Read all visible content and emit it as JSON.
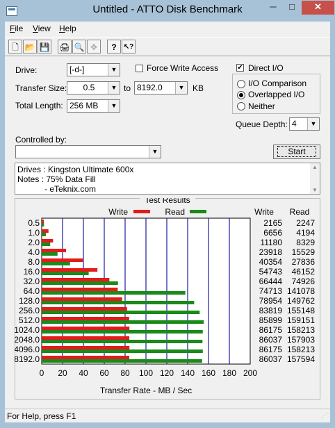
{
  "window": {
    "title": "Untitled - ATTO Disk Benchmark",
    "minimize": "─",
    "maximize": "□",
    "close": "✕"
  },
  "menu": [
    {
      "label": "File",
      "key": "F",
      "rest": "ile"
    },
    {
      "label": "View",
      "key": "V",
      "rest": "iew"
    },
    {
      "label": "Help",
      "key": "H",
      "rest": "elp"
    }
  ],
  "toolbar": [
    {
      "name": "new-icon",
      "glyph": "🗋"
    },
    {
      "name": "open-icon",
      "glyph": "📂"
    },
    {
      "name": "save-icon",
      "glyph": "💾"
    },
    {
      "name": "print-icon",
      "glyph": "🖨"
    },
    {
      "name": "print-preview-icon",
      "glyph": "🔍"
    },
    {
      "name": "move-icon",
      "glyph": "✥"
    },
    {
      "name": "help-icon",
      "glyph": "?"
    },
    {
      "name": "context-help-icon",
      "glyph": "↖?"
    }
  ],
  "settings": {
    "drive_label": "Drive:",
    "drive_value": "[-d-]",
    "transfer_size_label": "Transfer Size:",
    "transfer_from": "0.5",
    "to_label": "to",
    "transfer_to": "8192.0",
    "unit": "KB",
    "total_length_label": "Total Length:",
    "total_length_value": "256 MB",
    "force_write_label": "Force Write Access",
    "force_write_checked": false,
    "direct_io_label": "Direct I/O",
    "direct_io_checked": true,
    "io_comparison_label": "I/O Comparison",
    "overlapped_io_label": "Overlapped I/O",
    "neither_label": "Neither",
    "selected_mode": "Overlapped I/O",
    "queue_depth_label": "Queue Depth:",
    "queue_depth_value": "4",
    "controlled_by_label": "Controlled by:",
    "controlled_by_value": "",
    "start_label": "Start"
  },
  "notes": {
    "line1": "Drives : Kingston Ultimate 600x",
    "line2": "Notes : 75% Data Fill",
    "line3": "- eTeknix.com"
  },
  "results_title": "Test Results",
  "legend": {
    "write": "Write",
    "read": "Read",
    "write_color": "#e31b1b",
    "read_color": "#1a8a1a"
  },
  "table_headers": {
    "write": "Write",
    "read": "Read"
  },
  "chart_data": {
    "type": "bar",
    "orientation": "horizontal",
    "categories": [
      "0.5",
      "1.0",
      "2.0",
      "4.0",
      "8.0",
      "16.0",
      "32.0",
      "64.0",
      "128.0",
      "256.0",
      "512.0",
      "1024.0",
      "2048.0",
      "4096.0",
      "8192.0"
    ],
    "series": [
      {
        "name": "Write",
        "color": "#e31b1b",
        "values": [
          2165,
          6656,
          11180,
          23918,
          40354,
          54743,
          66444,
          74713,
          78954,
          83819,
          85899,
          86175,
          86037,
          86175,
          86037
        ]
      },
      {
        "name": "Read",
        "color": "#1a8a1a",
        "values": [
          2247,
          4194,
          8329,
          15529,
          27836,
          46152,
          74926,
          141078,
          149762,
          155148,
          159151,
          158213,
          157903,
          158213,
          157594
        ]
      }
    ],
    "xlabel": "Transfer Rate - MB / Sec",
    "xticks": [
      "0",
      "20",
      "40",
      "60",
      "80",
      "100",
      "120",
      "140",
      "160",
      "180",
      "200"
    ],
    "xlim": [
      0,
      200
    ],
    "grid": true
  },
  "status": {
    "text": "For Help, press F1"
  }
}
